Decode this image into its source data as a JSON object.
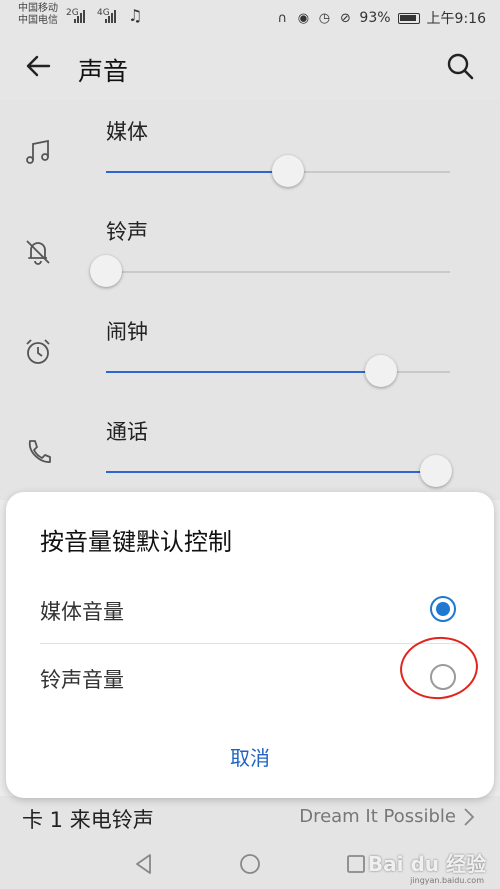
{
  "status_bar": {
    "carrier_1": "中国移动",
    "carrier_2": "中国电信",
    "net_1": "2G",
    "net_2": "4G",
    "battery": "93%",
    "time": "上午9:16"
  },
  "app_bar": {
    "title": "声音"
  },
  "volume_rows": [
    {
      "label": "媒体",
      "icon": "music-note-icon",
      "level": 0.53
    },
    {
      "label": "铃声",
      "icon": "bell-off-icon",
      "level": 0.0
    },
    {
      "label": "闹钟",
      "icon": "alarm-clock-icon",
      "level": 0.8
    },
    {
      "label": "通话",
      "icon": "phone-icon",
      "level": 0.96
    }
  ],
  "ringtone_row": {
    "label": "卡 1 来电铃声",
    "value": "Dream It Possible"
  },
  "dialog": {
    "title": "按音量键默认控制",
    "options": [
      {
        "label": "媒体音量",
        "selected": true
      },
      {
        "label": "铃声音量",
        "selected": false
      }
    ],
    "cancel_label": "取消"
  },
  "watermark": {
    "text": "Bai du 经验",
    "sub": "jingyan.baidu.com"
  },
  "colors": {
    "accent": "#1f78d1",
    "slider_fill": "#2e66d1",
    "annotation": "#e0261c"
  }
}
